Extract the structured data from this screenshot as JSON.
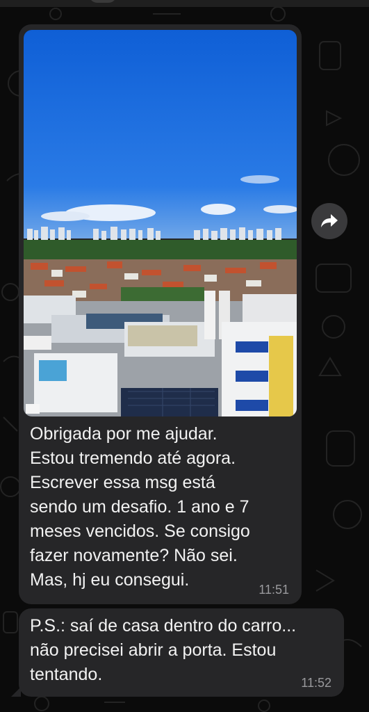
{
  "colors": {
    "chat_background": "#0b0b0b",
    "bubble": "#262628",
    "text": "#f2f2f2",
    "timestamp": "#9a9a9d",
    "forward_button": "#3a3a3c"
  },
  "messages": [
    {
      "type": "image_with_caption",
      "image_icon": "photo-city-view",
      "text": "Obrigada por me ajudar.\nEstou tremendo até agora.\nEscrever essa msg está\nsendo um desafio. 1 ano e 7\nmeses vencidos. Se consigo\nfazer novamente? Não sei.\nMas, hj eu consegui.",
      "time": "11:51"
    },
    {
      "type": "text",
      "text": "P.S.: saí de casa dentro do carro...\nnão precisei abrir a porta. Estou\ntentando.",
      "time": "11:52"
    }
  ],
  "actions": {
    "forward_icon": "forward-arrow-icon"
  }
}
